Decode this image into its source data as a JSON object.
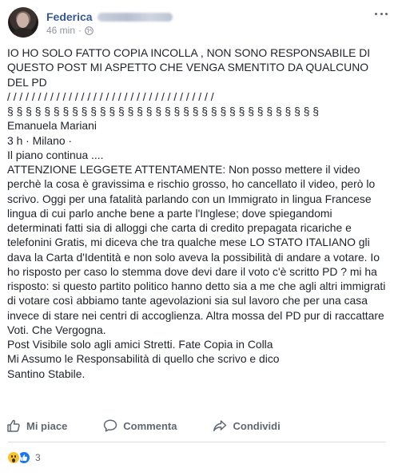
{
  "post": {
    "author": "Federica",
    "time": "46 min",
    "dot": "·",
    "privacy_icon": "globe-icon",
    "menu_icon": "more-options-icon"
  },
  "body": {
    "p1": "IO HO SOLO FATTO COPIA INCOLLA , NON SONO RESPONSABILE DI QUESTO POST MI ASPETTO CHE VENGA SMENTITO DA QUALCUNO DEL PD",
    "p2": "/ / / / / / / / / / / / / / / / / / / / / / / / / / / / / / / / / /",
    "p3": "§ § § § § § § § § § § § § § § § § § § § § § § § § § § § § § § § § §",
    "p4": "Emanuela Mariani",
    "p5": "3 h · Milano ·",
    "p6": "Il piano continua ....",
    "p7": "ATTENZIONE LEGGETE ATTENTAMENTE: Non posso mettere il video perchè la cosa è gravissima e rischio grosso, ho cancellato il video, però lo scrivo. Oggi per una fatalità parlando con un Immigrato in lingua Francese lingua di cui parlo anche bene a parte l'Inglese; dove spiegandomi determinati fatti sia di alloggi che carta di credito prepagata ricariche e telefonini Gratis, mi diceva che tra qualche mese LO STATO ITALIANO gli dava la Carta d'Identità e non solo aveva la possibilità di andare a votare. Io ho risposto per caso lo stemma dove devi dare il voto c'è scritto PD ? mi ha risposto: si questo partito politico hanno detto sia a me che agli altri immigrati di votare così abbiamo tante agevolazioni sia sul lavoro che per una casa invece di stare nei centri di accoglienza. Altra mossa del PD pur di raccattare Voti. Che Vergogna.",
    "p8": "Post Visibile solo agli amici Stretti. Fate Copia in Colla",
    "p9": "Mi Assumo le Responsabilità di quello che scrivo e dico",
    "p10": "Santino Stabile."
  },
  "actions": {
    "like": "Mi piace",
    "comment": "Commenta",
    "share": "Condividi"
  },
  "reactions": {
    "count": "3",
    "types": [
      "wow",
      "like"
    ],
    "colors": {
      "wow": "#f7c42b",
      "like": "#1877f2",
      "link": "#365899"
    }
  }
}
